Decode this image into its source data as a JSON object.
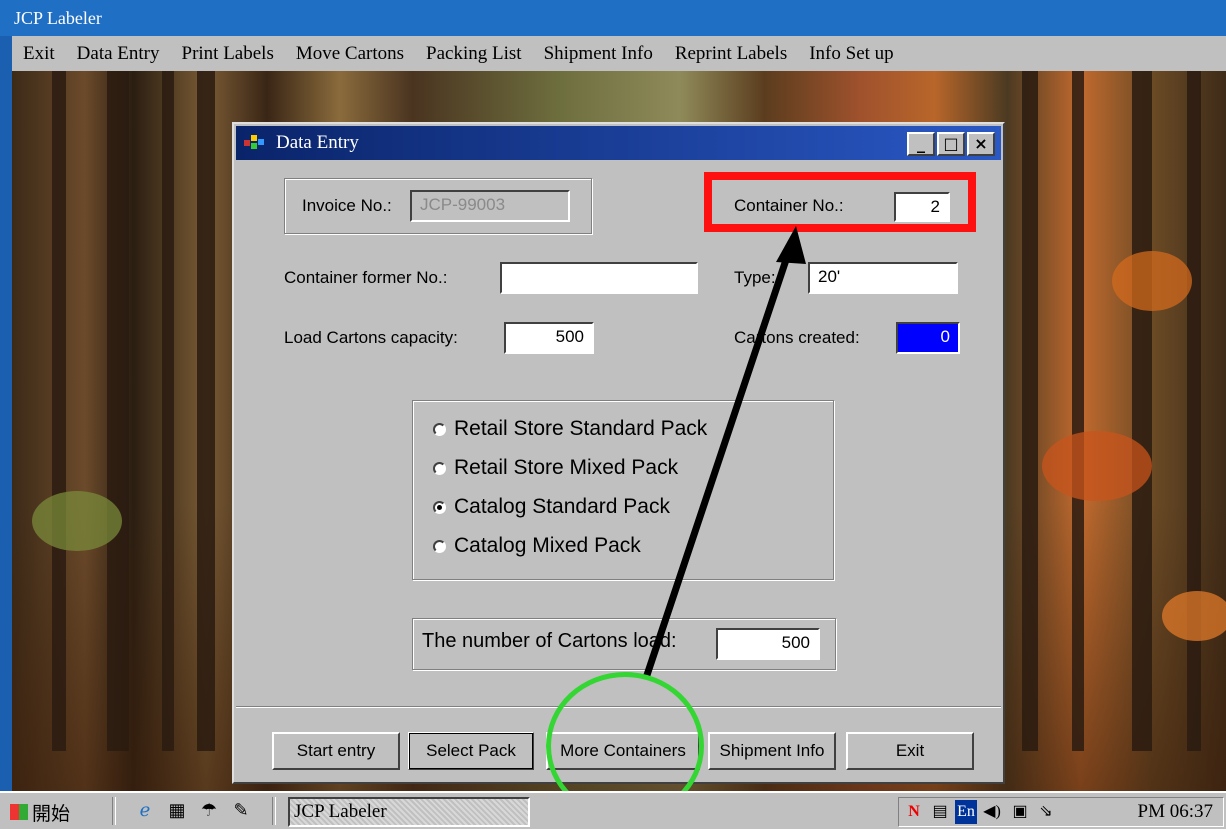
{
  "app": {
    "title": "JCP Labeler"
  },
  "menu": [
    "Exit",
    "Data Entry",
    "Print Labels",
    "Move Cartons",
    "Packing List",
    "Shipment Info",
    "Reprint Labels",
    "Info Set up"
  ],
  "dialog": {
    "title": "Data Entry",
    "invoice": {
      "label": "Invoice No.:",
      "value": "JCP-99003"
    },
    "container_no": {
      "label": "Container No.:",
      "value": "2"
    },
    "container_former": {
      "label": "Container former No.:",
      "value": ""
    },
    "type": {
      "label": "Type:",
      "value": "20'"
    },
    "load_capacity": {
      "label": "Load Cartons capacity:",
      "value": "500"
    },
    "cartons_created": {
      "label": "Cartons created:",
      "value": "0"
    },
    "pack_options": [
      {
        "label": "Retail Store Standard Pack",
        "selected": false
      },
      {
        "label": "Retail Store Mixed Pack",
        "selected": false
      },
      {
        "label": "Catalog Standard Pack",
        "selected": true
      },
      {
        "label": "Catalog Mixed Pack",
        "selected": false
      }
    ],
    "cartons_load": {
      "label": "The number of Cartons load:",
      "value": "500"
    },
    "buttons": {
      "start_entry": "Start entry",
      "select_pack": "Select Pack",
      "more_containers": "More Containers",
      "shipment_info": "Shipment Info",
      "exit": "Exit"
    }
  },
  "taskbar": {
    "start_label": "開始",
    "task_label": "JCP Labeler",
    "tray_lang": "En",
    "clock": "PM 06:37"
  },
  "colors": {
    "highlight_box": "#ff1010",
    "highlight_circle": "#33d633",
    "cartons_created_bg": "#0000ff",
    "title_bar": "#0a246a"
  }
}
